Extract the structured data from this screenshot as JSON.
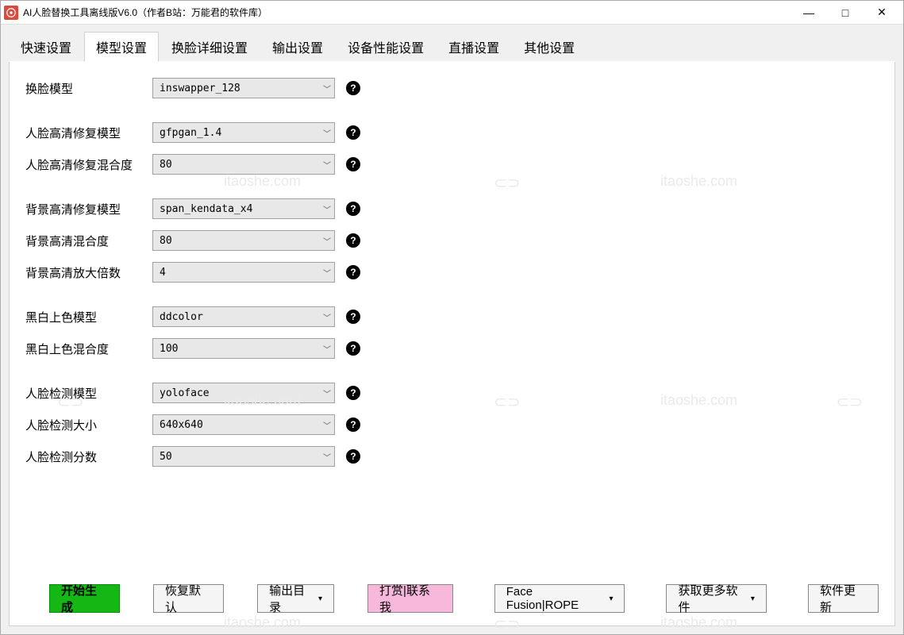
{
  "title": "AI人脸替换工具离线版V6.0（作者B站：万能君的软件库）",
  "tabs": [
    "快速设置",
    "模型设置",
    "换脸详细设置",
    "输出设置",
    "设备性能设置",
    "直播设置",
    "其他设置"
  ],
  "active_tab": 1,
  "fields": {
    "swap_model": {
      "label": "换脸模型",
      "value": "inswapper_128"
    },
    "face_enhance_model": {
      "label": "人脸高清修复模型",
      "value": "gfpgan_1.4"
    },
    "face_enhance_blend": {
      "label": "人脸高清修复混合度",
      "value": "80"
    },
    "bg_enhance_model": {
      "label": "背景高清修复模型",
      "value": "span_kendata_x4"
    },
    "bg_enhance_blend": {
      "label": "背景高清混合度",
      "value": "80"
    },
    "bg_upscale": {
      "label": "背景高清放大倍数",
      "value": "4"
    },
    "bw_color_model": {
      "label": "黑白上色模型",
      "value": "ddcolor"
    },
    "bw_color_blend": {
      "label": "黑白上色混合度",
      "value": "100"
    },
    "face_detect_model": {
      "label": "人脸检测模型",
      "value": "yoloface"
    },
    "face_detect_size": {
      "label": "人脸检测大小",
      "value": "640x640"
    },
    "face_detect_score": {
      "label": "人脸检测分数",
      "value": "50"
    }
  },
  "buttons": {
    "start": "开始生成",
    "reset": "恢复默认",
    "outdir": "输出目录",
    "donate": "打赏|联系我",
    "facefusion": "Face Fusion|ROPE",
    "getmore": "获取更多软件",
    "update": "软件更新"
  },
  "help_glyph": "?",
  "watermark": "itaoshe.com"
}
